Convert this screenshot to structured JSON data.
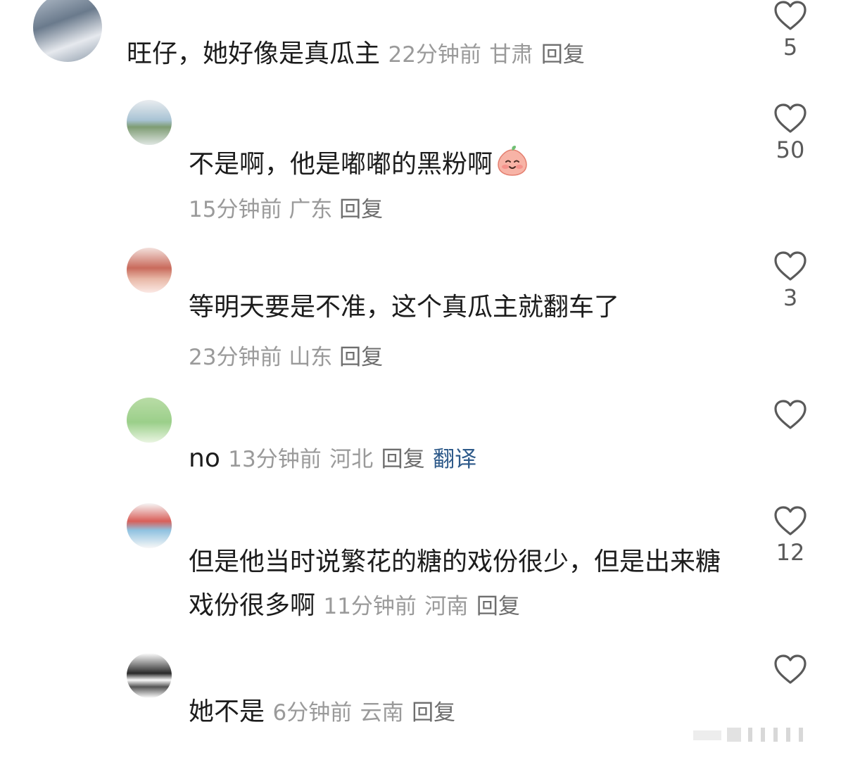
{
  "comments": [
    {
      "text": "旺仔，她好像是真瓜主",
      "time": "22分钟前",
      "location": "甘肃",
      "reply": "回复",
      "likes": "5"
    },
    {
      "text": "不是啊，他是嘟嘟的黑粉啊",
      "emoji": "smiling-peach-emoji",
      "time": "15分钟前",
      "location": "广东",
      "reply": "回复",
      "likes": "50"
    },
    {
      "text": "等明天要是不准，这个真瓜主就翻车了",
      "time": "23分钟前",
      "location": "山东",
      "reply": "回复",
      "likes": "3"
    },
    {
      "text": "no",
      "time": "13分钟前",
      "location": "河北",
      "reply": "回复",
      "translate": "翻译",
      "likes": ""
    },
    {
      "text": "但是他当时说繁花的糖的戏份很少，但是出来糖戏份很多啊",
      "time": "11分钟前",
      "location": "河南",
      "reply": "回复",
      "likes": "12"
    },
    {
      "text": "她不是",
      "time": "6分钟前",
      "location": "云南",
      "reply": "回复",
      "likes": ""
    }
  ],
  "colors": {
    "text": "#1c1c1c",
    "meta": "#9a9a9a",
    "reply": "#6e6e6e",
    "translate": "#2e5a8a",
    "heart": "#5a5a5a"
  },
  "icons": {
    "like": "heart-outline-icon"
  }
}
